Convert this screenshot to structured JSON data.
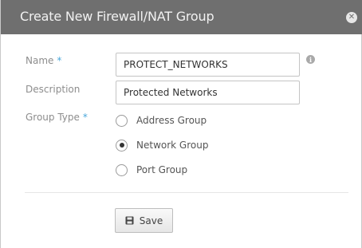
{
  "dialog": {
    "title": "Create New Firewall/NAT Group",
    "close_icon": "close-icon"
  },
  "form": {
    "name": {
      "label": "Name",
      "required_marker": "*",
      "value": "PROTECT_NETWORKS",
      "info_icon": "info-icon",
      "info_glyph": "i"
    },
    "description": {
      "label": "Description",
      "value": "Protected Networks"
    },
    "group_type": {
      "label": "Group Type",
      "required_marker": "*",
      "options": [
        {
          "label": "Address Group",
          "selected": false
        },
        {
          "label": "Network Group",
          "selected": true
        },
        {
          "label": "Port Group",
          "selected": false
        }
      ]
    }
  },
  "actions": {
    "save_label": "Save",
    "save_icon": "save-icon"
  },
  "colors": {
    "titlebar": "#6f6f6f",
    "required_marker": "#4aa8db"
  }
}
